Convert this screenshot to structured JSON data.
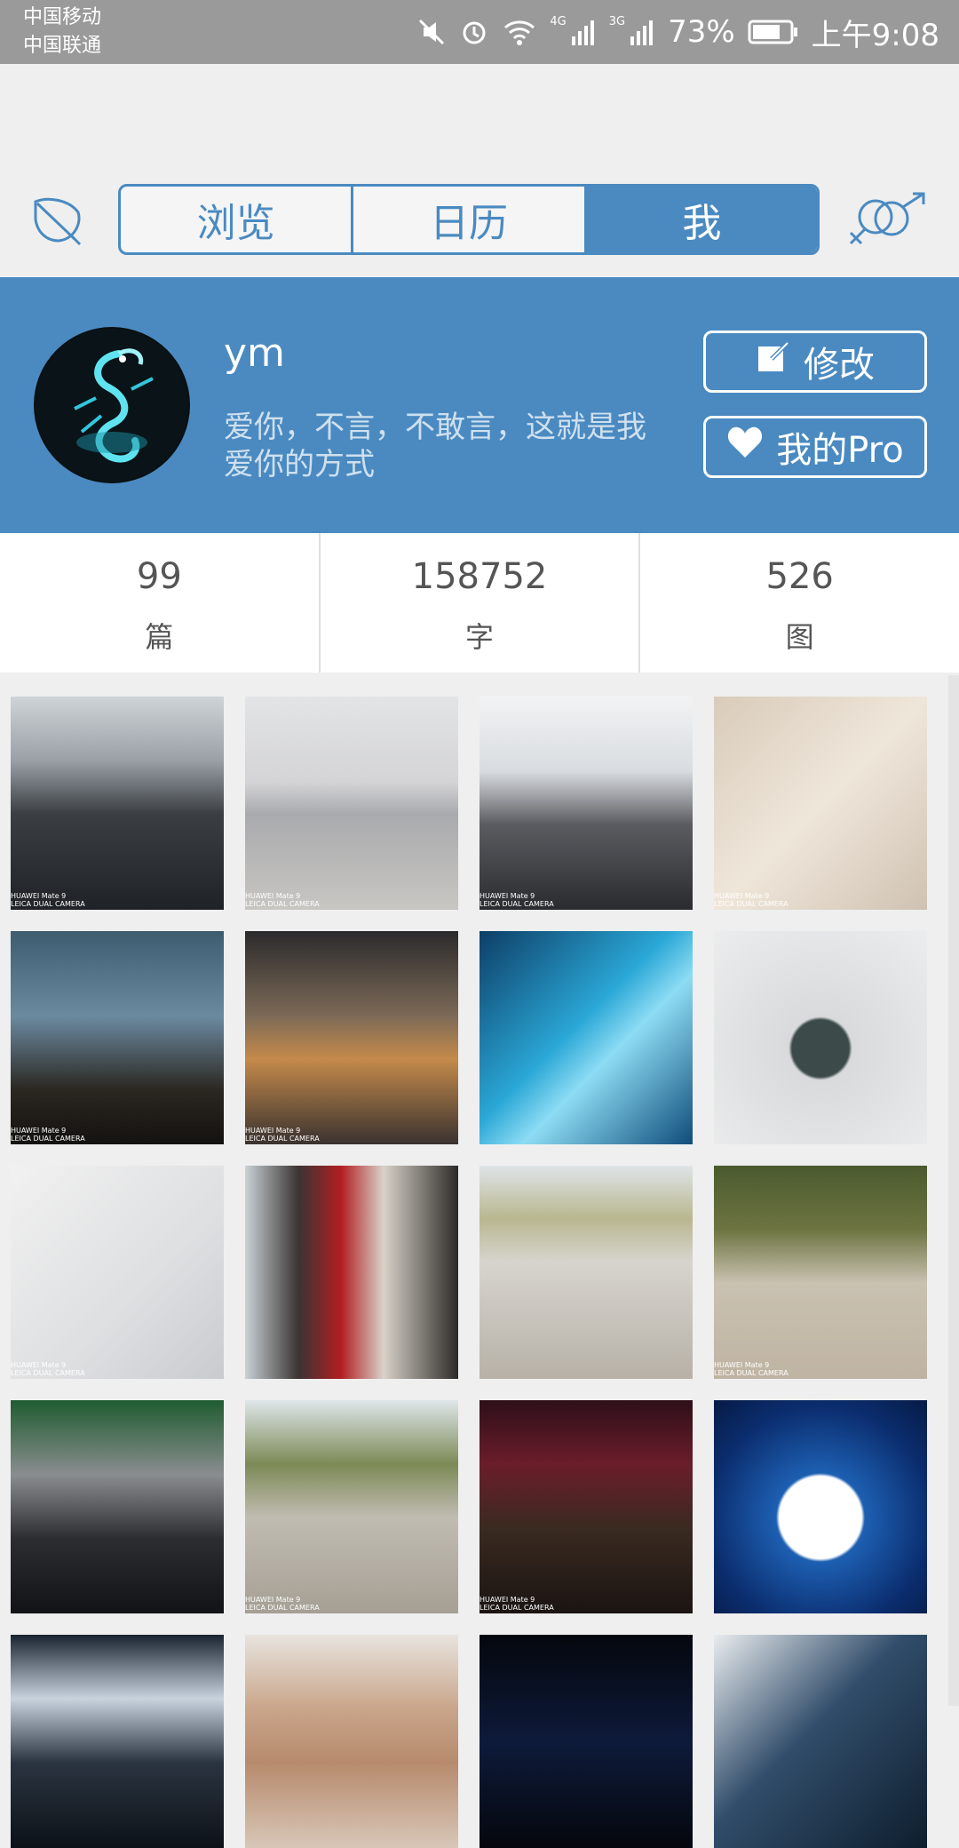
{
  "status_bar": {
    "carrier_1": "中国移动",
    "carrier_2": "中国联通",
    "net_1": "4G",
    "net_2": "3G",
    "battery": "73%",
    "time": "上午9:08"
  },
  "nav": {
    "tabs": [
      {
        "label": "浏览",
        "active": false
      },
      {
        "label": "日历",
        "active": false
      },
      {
        "label": "我",
        "active": true
      }
    ],
    "accent": "#4a8ac1"
  },
  "profile": {
    "username": "ym",
    "bio": "爱你，不言，不敢言，这就是我爱你的方式",
    "edit_label": "修改",
    "pro_label": "我的Pro"
  },
  "stats": [
    {
      "value": "99",
      "label": "篇"
    },
    {
      "value": "158752",
      "label": "字"
    },
    {
      "value": "526",
      "label": "图"
    }
  ],
  "photos": [
    {
      "caption": "HUAWEI Mate 9\nLEICA DUAL CAMERA"
    },
    {
      "caption": "HUAWEI Mate 9\nLEICA DUAL CAMERA"
    },
    {
      "caption": "HUAWEI Mate 9\nLEICA DUAL CAMERA"
    },
    {
      "caption": "HUAWEI Mate 9\nLEICA DUAL CAMERA"
    },
    {
      "caption": "HUAWEI Mate 9\nLEICA DUAL CAMERA"
    },
    {
      "caption": "HUAWEI Mate 9\nLEICA DUAL CAMERA"
    },
    {
      "caption": ""
    },
    {
      "caption": ""
    },
    {
      "caption": "HUAWEI Mate 9\nLEICA DUAL CAMERA"
    },
    {
      "caption": ""
    },
    {
      "caption": ""
    },
    {
      "caption": "HUAWEI Mate 9\nLEICA DUAL CAMERA"
    },
    {
      "caption": ""
    },
    {
      "caption": "HUAWEI Mate 9\nLEICA DUAL CAMERA"
    },
    {
      "caption": "HUAWEI Mate 9\nLEICA DUAL CAMERA"
    },
    {
      "caption": ""
    },
    {
      "caption": ""
    },
    {
      "caption": ""
    },
    {
      "caption": ""
    },
    {
      "caption": ""
    }
  ]
}
